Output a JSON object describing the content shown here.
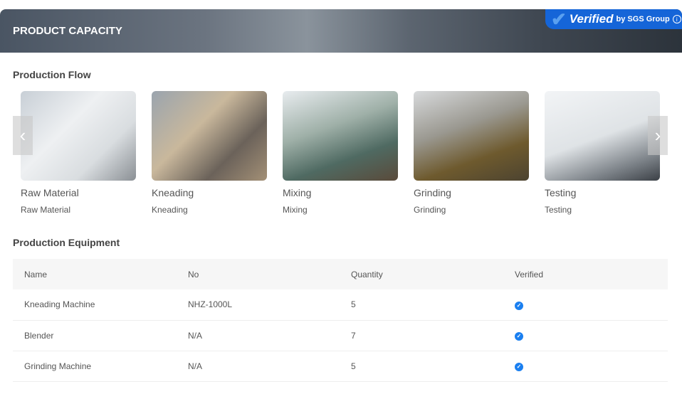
{
  "header": {
    "title": "PRODUCT CAPACITY",
    "badge_mark": "Verified",
    "badge_by": "by SGS Group",
    "badge_info": "i"
  },
  "flow": {
    "title": "Production Flow",
    "items": [
      {
        "title": "Raw Material",
        "sub": "Raw Material"
      },
      {
        "title": "Kneading",
        "sub": "Kneading"
      },
      {
        "title": "Mixing",
        "sub": "Mixing"
      },
      {
        "title": "Grinding",
        "sub": "Grinding"
      },
      {
        "title": "Testing",
        "sub": "Testing"
      }
    ],
    "prev": "‹",
    "next": "›"
  },
  "equipment": {
    "title": "Production Equipment",
    "columns": [
      "Name",
      "No",
      "Quantity",
      "Verified"
    ],
    "rows": [
      {
        "name": "Kneading Machine",
        "no": "NHZ-1000L",
        "qty": "5",
        "verified": "✓"
      },
      {
        "name": "Blender",
        "no": "N/A",
        "qty": "7",
        "verified": "✓"
      },
      {
        "name": "Grinding Machine",
        "no": "N/A",
        "qty": "5",
        "verified": "✓"
      }
    ]
  }
}
